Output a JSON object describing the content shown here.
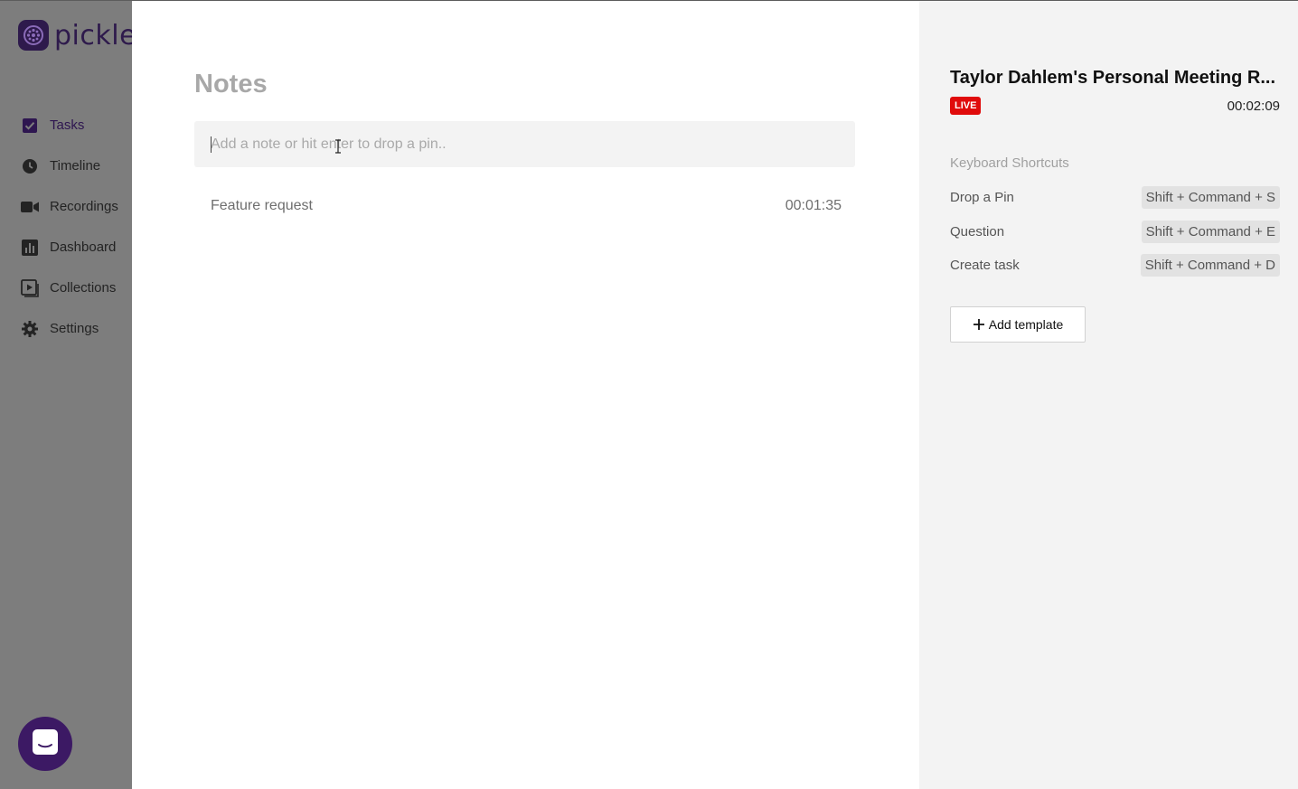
{
  "app": {
    "name": "pickle",
    "brand_color": "#2e1a4c"
  },
  "sidebar": {
    "items": [
      {
        "label": "Tasks",
        "icon": "checkbox-icon",
        "active": true
      },
      {
        "label": "Timeline",
        "icon": "clock-icon"
      },
      {
        "label": "Recordings",
        "icon": "video-camera-icon"
      },
      {
        "label": "Dashboard",
        "icon": "bar-chart-icon"
      },
      {
        "label": "Collections",
        "icon": "collection-play-icon"
      },
      {
        "label": "Settings",
        "icon": "gear-icon"
      }
    ]
  },
  "notes": {
    "title": "Notes",
    "input_placeholder": "Add a note or hit enter to drop a pin..",
    "items": [
      {
        "text": "Feature request",
        "time": "00:01:35"
      }
    ]
  },
  "meeting": {
    "title": "Taylor Dahlem's Personal Meeting R...",
    "live_label": "LIVE",
    "live_color": "#e00b0b",
    "elapsed": "00:02:09"
  },
  "shortcuts": {
    "heading": "Keyboard Shortcuts",
    "items": [
      {
        "label": "Drop a Pin",
        "keys": "Shift + Command + S"
      },
      {
        "label": "Question",
        "keys": "Shift + Command + E"
      },
      {
        "label": "Create task",
        "keys": "Shift + Command + D"
      }
    ]
  },
  "actions": {
    "add_template": "Add template"
  },
  "chat": {
    "icon": "chat-launcher-icon"
  }
}
